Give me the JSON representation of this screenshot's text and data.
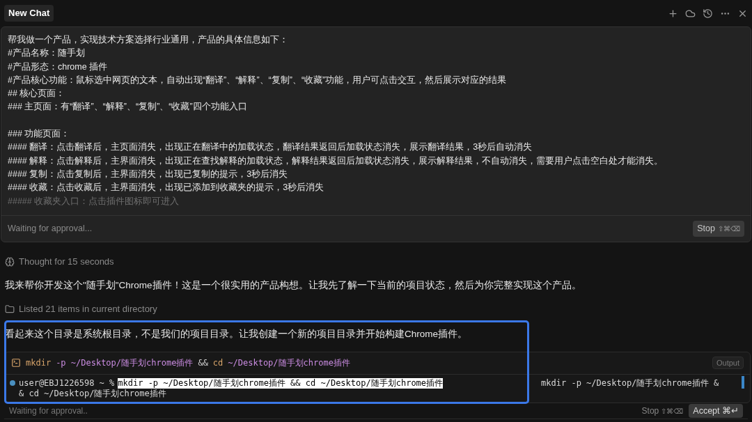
{
  "header": {
    "tab": "New Chat"
  },
  "prompt": {
    "lines": [
      {
        "text": "帮我做一个产品，实现技术方案选择行业通用，产品的具体信息如下：",
        "faded": false
      },
      {
        "text": "#产品名称：随手划",
        "faded": false
      },
      {
        "text": "#产品形态：chrome 插件",
        "faded": false
      },
      {
        "text": "#产品核心功能：鼠标选中网页的文本，自动出现“翻译”、“解释”、“复制”、“收藏”功能，用户可点击交互，然后展示对应的结果",
        "faded": false
      },
      {
        "text": "## 核心页面：",
        "faded": false
      },
      {
        "text": "### 主页面：有“翻译”、“解释”、“复制”、“收藏”四个功能入口",
        "faded": false
      },
      {
        "kind": "blank"
      },
      {
        "text": "### 功能页面：",
        "faded": false
      },
      {
        "text": "#### 翻译：点击翻译后，主页面消失，出现正在翻译中的加载状态，翻译结果返回后加载状态消失，展示翻译结果，3秒后自动消失",
        "faded": false
      },
      {
        "text": "#### 解释：点击解释后，主界面消失，出现正在查找解释的加载状态，解释结果返回后加载状态消失，展示解释结果，不自动消失，需要用户点击空白处才能消失。",
        "faded": false
      },
      {
        "text": "#### 复制：点击复制后，主界面消失，出现已复制的提示，3秒后消失",
        "faded": false
      },
      {
        "text": "#### 收藏：点击收藏后，主界面消失，出现已添加到收藏夹的提示，3秒后消失",
        "faded": false
      },
      {
        "text": "##### 收藏夹入口：点击插件图标即可进入",
        "faded": true
      }
    ],
    "status": "Waiting for approval...",
    "stop": "Stop",
    "stop_keys": "⇧⌘⌫"
  },
  "thought": "Thought for 15 seconds",
  "reply": "我来帮你开发这个\"随手划\"Chrome插件！这是一个很实用的产品构想。让我先了解一下当前的项目状态，然后为你完整实现这个产品。",
  "listed": "Listed 21 items in current directory",
  "message": "看起来这个目录是系统根目录，不是我们的项目目录。让我创建一个新的项目目录并开始构建Chrome插件。",
  "terminal": {
    "command": [
      {
        "text": "mkdir",
        "kind": "program"
      },
      {
        "text": "-p ~/Desktop/随手划chrome插件",
        "kind": "argument"
      },
      {
        "text": "&&",
        "kind": "operator"
      },
      {
        "text": "cd",
        "kind": "program"
      },
      {
        "text": "~/Desktop/随手划chrome插件",
        "kind": "argument"
      }
    ],
    "output_button": "Output",
    "prompt": "user@EBJ1226598 ~ %",
    "selected_input": "mkdir -p ~/Desktop/随手划chrome插件 && cd ~/Desktop/随手划chrome插件",
    "echo": "mkdir -p ~/Desktop/随手划chrome插件 &",
    "wrap": "& cd ~/Desktop/随手划chrome插件"
  },
  "footer": {
    "status": "Waiting for approval..",
    "stop": "Stop",
    "stop_keys": "⇧⌘⌫",
    "accept": "Accept",
    "accept_keys": "⌘↵"
  }
}
